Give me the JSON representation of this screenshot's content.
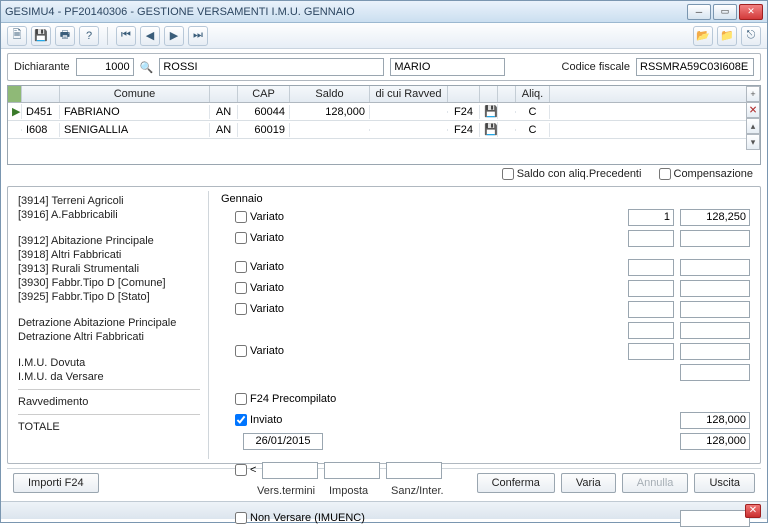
{
  "window": {
    "title": "GESIMU4  -  PF20140306  -  GESTIONE VERSAMENTI I.M.U. GENNAIO"
  },
  "declarer": {
    "label": "Dichiarante",
    "code": "1000",
    "surname": "ROSSI",
    "name": "MARIO",
    "fiscal_label": "Codice fiscale",
    "fiscal_code": "RSSMRA59C03I608E"
  },
  "grid": {
    "headers": {
      "comune": "Comune",
      "cap": "CAP",
      "saldo": "Saldo",
      "ravved": "di cui Ravved",
      "aliq": "Aliq."
    },
    "rows": [
      {
        "mark": "▶",
        "code": "D451",
        "comune": "FABRIANO",
        "prov": "AN",
        "cap": "60044",
        "saldo": "128,000",
        "ravved": "",
        "f24": "F24",
        "aliq": "C"
      },
      {
        "mark": "",
        "code": "I608",
        "comune": "SENIGALLIA",
        "prov": "AN",
        "cap": "60019",
        "saldo": "",
        "ravved": "",
        "f24": "F24",
        "aliq": "C"
      }
    ]
  },
  "options": {
    "saldo_preced": "Saldo con aliq.Precedenti",
    "compensazione": "Compensazione"
  },
  "left": [
    "[3914] Terreni Agricoli",
    "[3916] A.Fabbricabili",
    "",
    "[3912] Abitazione Principale",
    "[3918] Altri Fabbricati",
    "[3913] Rurali Strumentali",
    "[3930] Fabbr.Tipo D [Comune]",
    "[3925] Fabbr.Tipo D [Stato]",
    "",
    "Detrazione Abitazione Principale",
    "Detrazione Altri Fabbricati",
    "",
    "I.M.U. Dovuta",
    "I.M.U. da Versare",
    "",
    "Ravvedimento",
    "",
    "TOTALE"
  ],
  "right": {
    "header": "Gennaio",
    "variato": "Variato",
    "v1_count": "1",
    "v1_value": "128,250",
    "f24pre": "F24 Precompilato",
    "inviato": "Inviato",
    "inviato_val": "128,000",
    "date": "26/01/2015",
    "date_val": "128,000",
    "lt": "<",
    "vers": "Vers.termini",
    "imposta": "Imposta",
    "sanz": "Sanz/Inter.",
    "nonversare": "Non Versare (IMUENC)"
  },
  "buttons": {
    "importi": "Importi F24",
    "conferma": "Conferma",
    "varia": "Varia",
    "annulla": "Annulla",
    "uscita": "Uscita"
  }
}
